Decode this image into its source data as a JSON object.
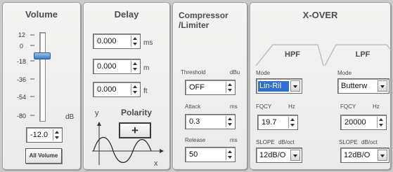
{
  "volume": {
    "title": "Volume",
    "scale_ticks": [
      "12",
      "0",
      "-18",
      "-36",
      "-54",
      "-80"
    ],
    "unit": "dB",
    "value": "-12.0",
    "all_button": "All Volume",
    "slider_level_db": -12
  },
  "delay": {
    "title": "Delay",
    "rows": [
      {
        "value": "0.000",
        "unit": "ms"
      },
      {
        "value": "0.000",
        "unit": "m"
      },
      {
        "value": "0.000",
        "unit": "ft"
      }
    ],
    "polarity_title": "Polarity",
    "polarity_button": "+",
    "axis_y": "y",
    "axis_x": "x"
  },
  "compressor": {
    "title_line1": "Compressor",
    "title_line2": "/Limiter",
    "threshold_label": "Threshold",
    "threshold_unit": "dBu",
    "threshold_value": "OFF",
    "attack_label": "Attack",
    "attack_unit": "ms",
    "attack_value": "0.3",
    "release_label": "Release",
    "release_unit": "ms",
    "release_value": "50"
  },
  "xover": {
    "title": "X-OVER",
    "hpf": {
      "tab": "HPF",
      "mode_label": "Mode",
      "mode_value": "Lin-Ril",
      "fqcy_label": "FQCY",
      "fqcy_unit": "Hz",
      "fqcy_value": "19.7",
      "slope_label": "SLOPE",
      "slope_unit": "dB/oct",
      "slope_value": "12dB/O"
    },
    "lpf": {
      "tab": "LPF",
      "mode_label": "Mode",
      "mode_value": "Butterw",
      "fqcy_label": "FQCY",
      "fqcy_unit": "Hz",
      "fqcy_value": "20000",
      "slope_label": "SLOPE",
      "slope_unit": "dB/oct",
      "slope_value": "12dB/O"
    }
  }
}
